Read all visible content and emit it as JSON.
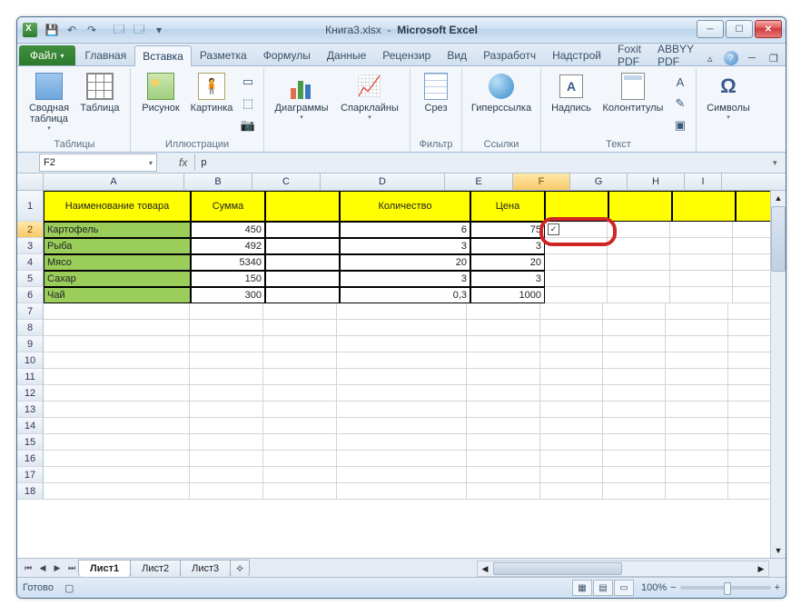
{
  "titlebar": {
    "doc": "Книга3.xlsx",
    "app": "Microsoft Excel"
  },
  "tabs": {
    "file": "Файл",
    "items": [
      "Главная",
      "Вставка",
      "Разметка",
      "Формулы",
      "Данные",
      "Рецензир",
      "Вид",
      "Разработч",
      "Надстрой",
      "Foxit PDF",
      "ABBYY PDF"
    ],
    "active_index": 1
  },
  "ribbon": {
    "tables": {
      "label": "Таблицы",
      "pivot": "Сводная таблица",
      "table": "Таблица"
    },
    "illustrations": {
      "label": "Иллюстрации",
      "picture": "Рисунок",
      "clipart": "Картинка"
    },
    "charts": {
      "label": "",
      "charts": "Диаграммы",
      "sparklines": "Спарклайны"
    },
    "filter": {
      "label": "Фильтр",
      "slicer": "Срез"
    },
    "links": {
      "label": "Ссылки",
      "hyperlink": "Гиперссылка"
    },
    "text": {
      "label": "Текст",
      "textbox": "Надпись",
      "header": "Колонтитулы"
    },
    "symbols": {
      "label": "",
      "symbol": "Символы"
    }
  },
  "formulabar": {
    "namebox": "F2",
    "fx": "fx",
    "formula": "р"
  },
  "columns": [
    "A",
    "B",
    "C",
    "D",
    "E",
    "F",
    "G",
    "H",
    "I"
  ],
  "active_col": "F",
  "active_row": 2,
  "headers": {
    "A": "Наименование товара",
    "B": "Сумма",
    "D": "Количество",
    "E": "Цена"
  },
  "data_rows": [
    {
      "A": "Картофель",
      "B": "450",
      "D": "6",
      "E": "75"
    },
    {
      "A": "Рыба",
      "B": "492",
      "D": "3",
      "E": "3"
    },
    {
      "A": "Мясо",
      "B": "5340",
      "D": "20",
      "E": "20"
    },
    {
      "A": "Сахар",
      "B": "150",
      "D": "3",
      "E": "3"
    },
    {
      "A": "Чай",
      "B": "300",
      "D": "0,3",
      "E": "1000"
    }
  ],
  "visible_rows_total": 18,
  "sheets": {
    "active": "Лист1",
    "others": [
      "Лист2",
      "Лист3"
    ]
  },
  "statusbar": {
    "status": "Готово",
    "zoom": "100%"
  }
}
